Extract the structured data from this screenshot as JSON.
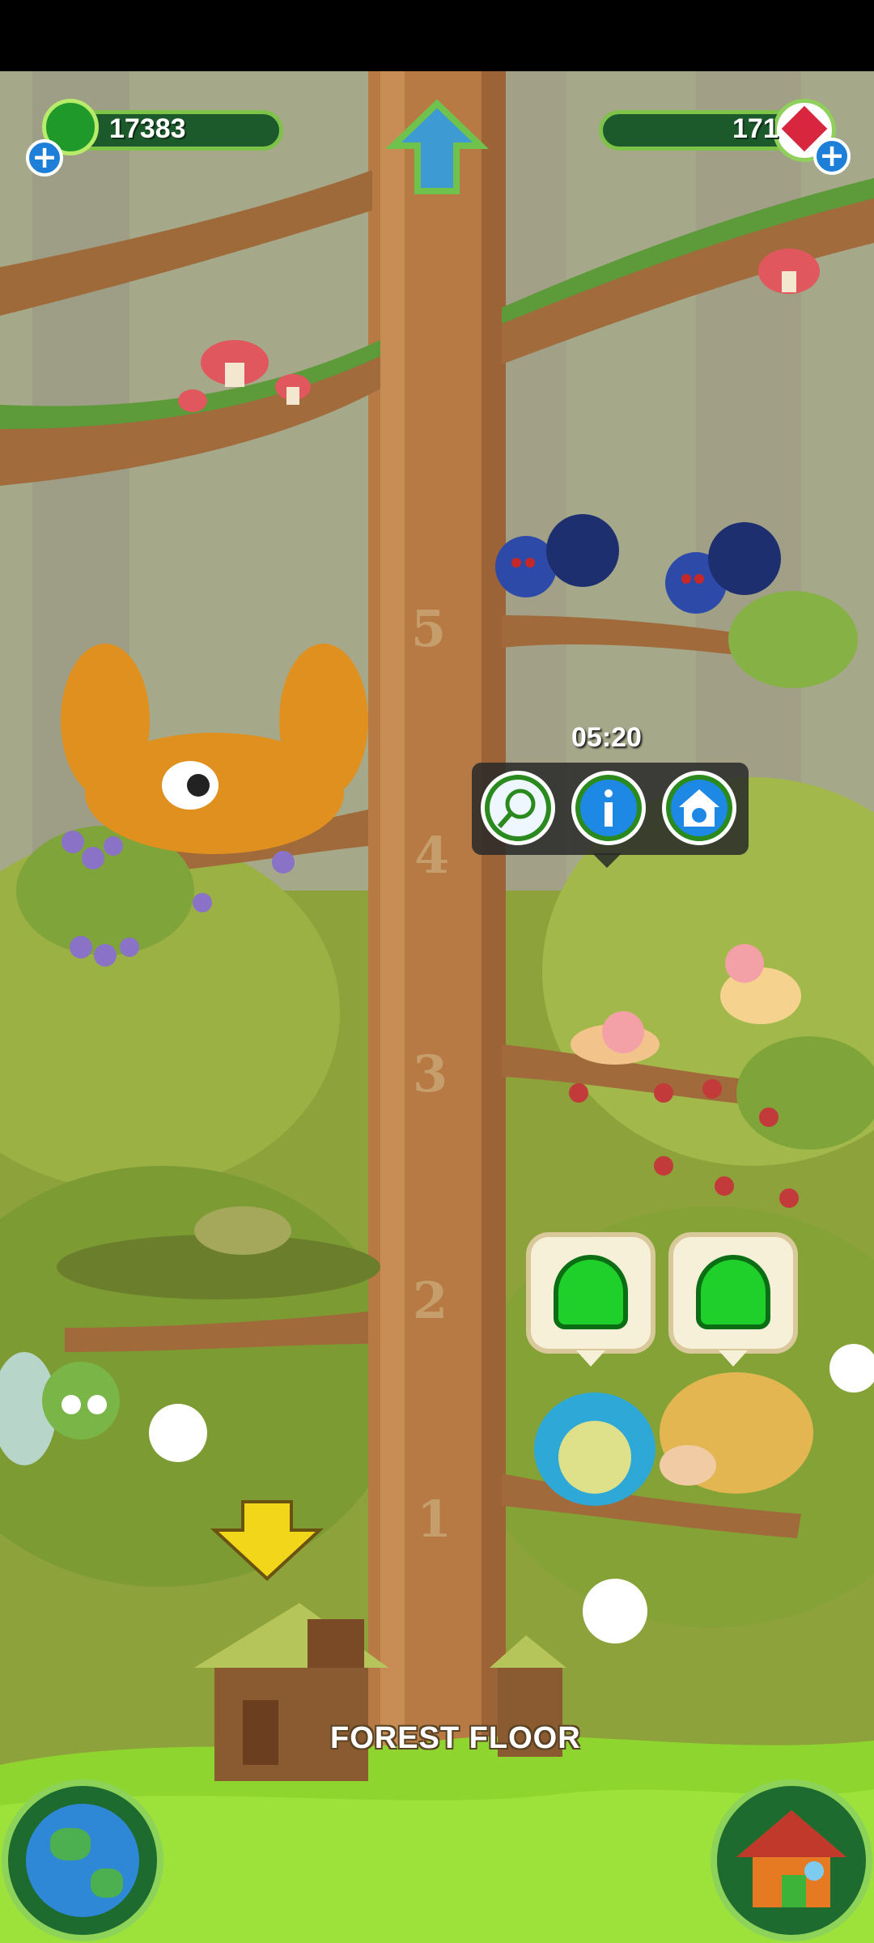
{
  "hud": {
    "left_currency": {
      "value": "17383",
      "icon": "green-jelly-icon",
      "plus_icon": "plus-icon"
    },
    "right_currency": {
      "value": "171",
      "icon": "red-gem-icon",
      "plus_icon": "plus-icon"
    },
    "top_button_icon": "up-arrow-icon"
  },
  "tree": {
    "level_labels": [
      "5",
      "4",
      "3",
      "2",
      "1"
    ],
    "floor_label": "FOREST FLOOR"
  },
  "popup": {
    "timer": "05:20",
    "buttons": [
      "net-icon",
      "info-icon",
      "house-pet-icon"
    ]
  },
  "collect_bubbles": [
    "green-jelly-icon",
    "green-jelly-icon"
  ],
  "bottom": {
    "left_button_icon": "globe-icon",
    "right_button_icon": "house-icon"
  },
  "colors": {
    "trunk": "#b77a44",
    "foliage": "#7aa33a",
    "hud_bar": "#1c5a2c",
    "grass": "#8ed62f"
  }
}
